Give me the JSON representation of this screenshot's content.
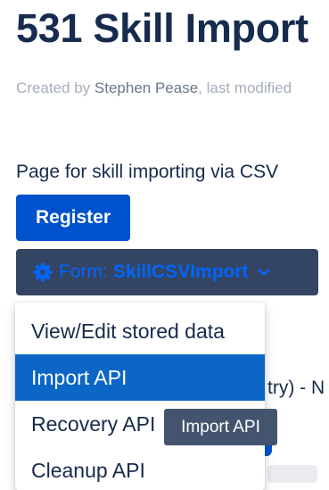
{
  "page": {
    "title": "531 Skill Import",
    "byline_prefix": "Created by ",
    "author": "Stephen Pease",
    "byline_suffix": ", last modified",
    "description": "Page for skill importing via CSV"
  },
  "buttons": {
    "register_label": "Register",
    "form_prefix": "Form:",
    "form_name": "SkillCSVImport"
  },
  "background": {
    "partial_text": "try) - N"
  },
  "dropdown": {
    "items": [
      {
        "label": "View/Edit stored data",
        "active": false
      },
      {
        "label": "Import API",
        "active": true
      },
      {
        "label": "Recovery API",
        "active": false
      },
      {
        "label": "Cleanup API",
        "active": false
      }
    ]
  },
  "tooltip": {
    "text": "Import API"
  },
  "colors": {
    "primary": "#0052cc",
    "form_button_bg": "#344563",
    "form_text": "#0065ff",
    "active_item": "#0c66c6",
    "tooltip_bg": "#44546f"
  },
  "icons": {
    "form": "gear-icon",
    "form_dropdown": "chevron-down-icon"
  }
}
